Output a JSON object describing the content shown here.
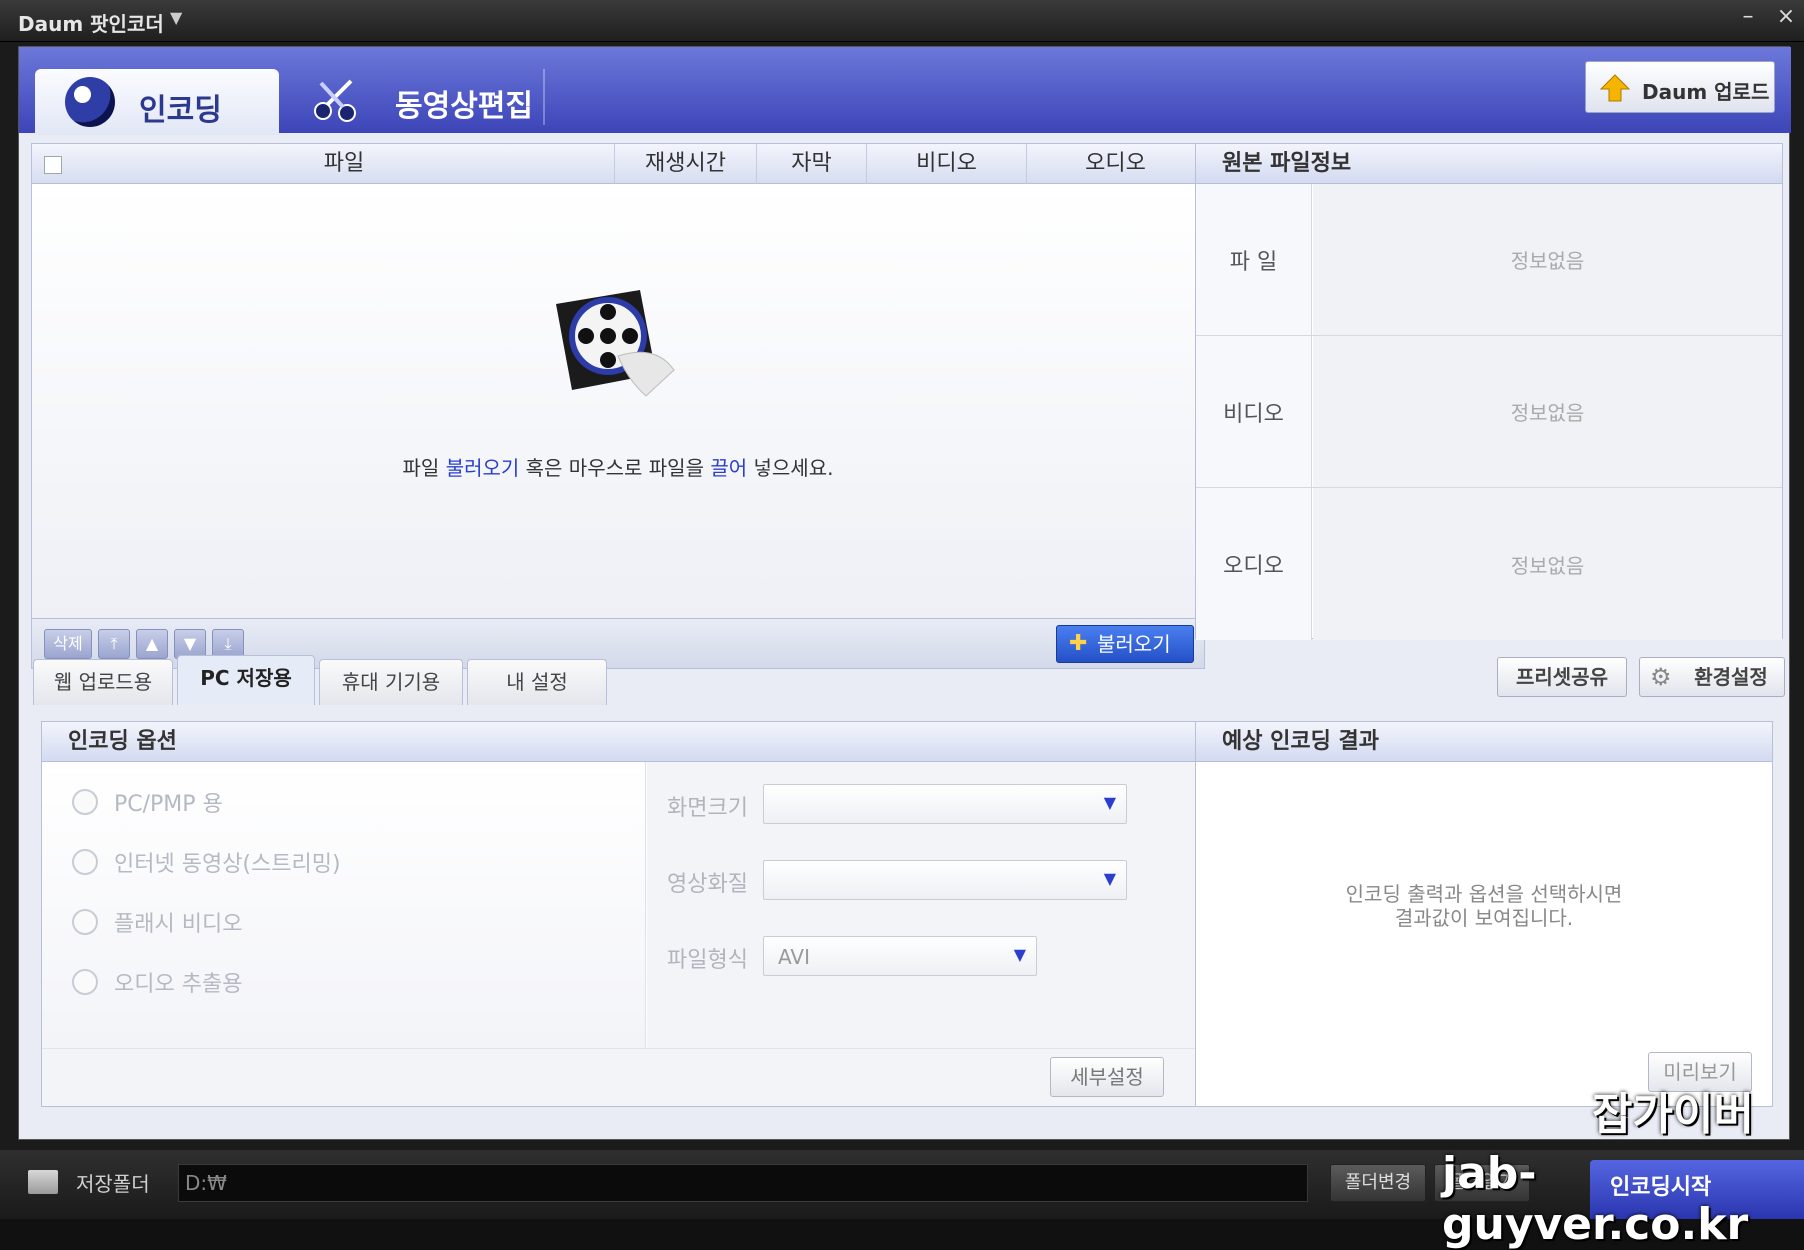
{
  "window": {
    "title": "Daum 팟인코더"
  },
  "top_tabs": [
    {
      "label": "인코딩",
      "icon": "film-reel-icon"
    },
    {
      "label": "동영상편집",
      "icon": "scissors-icon"
    }
  ],
  "daum_upload": {
    "label": "Daum 업로드",
    "icon": "upload-arrow-icon"
  },
  "file_list": {
    "columns": [
      "파일",
      "재생시간",
      "자막",
      "비디오",
      "오디오"
    ],
    "empty_message": {
      "pre": "파일 ",
      "link1": "불러오기",
      "mid": " 혹은 마우스로 파일을 ",
      "link2": "끌어",
      "post": " 넣으세요."
    },
    "toolbar": {
      "delete_label": "삭제",
      "load_label": "불러오기"
    }
  },
  "source_info": {
    "title": "원본 파일정보",
    "rows": [
      {
        "key": "파    일",
        "value": "정보없음"
      },
      {
        "key": "비디오",
        "value": "정보없음"
      },
      {
        "key": "오디오",
        "value": "정보없음"
      }
    ]
  },
  "option_tabs": [
    {
      "label": "웹 업로드용",
      "active": false
    },
    {
      "label": "PC 저장용",
      "active": true
    },
    {
      "label": "휴대 기기용",
      "active": false
    },
    {
      "label": "내 설정",
      "active": false
    }
  ],
  "preset_share": {
    "label": "프리셋공유"
  },
  "settings": {
    "label": "환경설정",
    "icon": "gear-icon"
  },
  "encoding_options": {
    "title": "인코딩 옵션",
    "radios": [
      "PC/PMP 용",
      "인터넷 동영상(스트리밍)",
      "플래시 비디오",
      "오디오 추출용"
    ],
    "fields": [
      {
        "label": "화면크기",
        "value": ""
      },
      {
        "label": "영상화질",
        "value": ""
      },
      {
        "label": "파일형식",
        "value": "AVI"
      }
    ],
    "detail_label": "세부설정"
  },
  "expected_result": {
    "title": "예상 인코딩 결과",
    "message_line1": "인코딩 출력과 옵션을 선택하시면",
    "message_line2": "결과값이 보여집니다.",
    "preview_label": "미리보기"
  },
  "bottom": {
    "folder_label": "저장폴더",
    "path_value": "D:₩",
    "change_folder_label": "폴더변경",
    "open_folder_label": "폴더열기",
    "start_label": "인코딩시작"
  },
  "watermark": {
    "line1": "잡가이버",
    "line2": "jab-guyver.co.kr"
  },
  "colors": {
    "accent": "#3d45b8",
    "header_band": "#6c78da",
    "load_button": "#2450c7"
  }
}
